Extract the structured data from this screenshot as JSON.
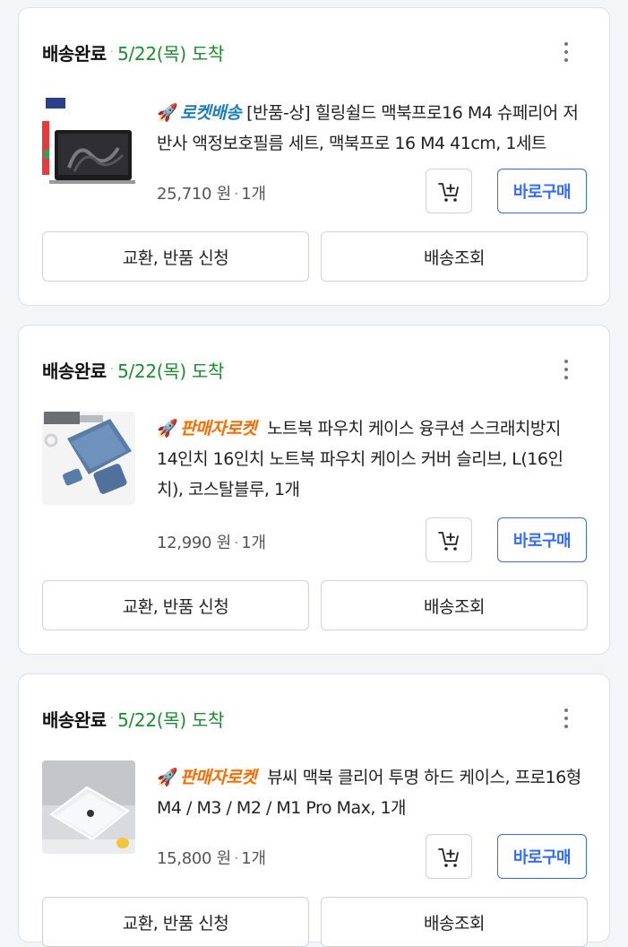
{
  "orders": [
    {
      "status": "배송완료",
      "separator": "·",
      "eta": "5/22(목) 도착",
      "badge": "로켓배송",
      "badge_icon": "rocket-icon",
      "title": "[반품-상] 힐링쉴드 맥북프로16 M4 슈페리어 저반사 액정보호필름 세트, 맥북프로 16 M4 41cm, 1세트",
      "price": "25,710 원",
      "quantity": "1개",
      "buy_label": "바로구매",
      "exchange_label": "교환, 반품 신청",
      "tracking_label": "배송조회"
    },
    {
      "status": "배송완료",
      "separator": "·",
      "eta": "5/22(목) 도착",
      "badge": "판매자로켓",
      "badge_icon": "rocket-icon",
      "title": "노트북 파우치 케이스 융쿠션 스크래치방지 14인치 16인치 노트북 파우치 케이스 커버 슬리브, L(16인치), 코스탈블루, 1개",
      "price": "12,990 원",
      "quantity": "1개",
      "buy_label": "바로구매",
      "exchange_label": "교환, 반품 신청",
      "tracking_label": "배송조회"
    },
    {
      "status": "배송완료",
      "separator": "·",
      "eta": "5/22(목) 도착",
      "badge": "판매자로켓",
      "badge_icon": "rocket-icon",
      "title": "뷰씨 맥북 클리어 투명 하드 케이스, 프로16형 M4 / M3 / M2 / M1 Pro Max, 1개",
      "price": "15,800 원",
      "quantity": "1개",
      "buy_label": "바로구매",
      "exchange_label": "교환, 반품 신청",
      "tracking_label": "배송조회"
    }
  ],
  "colors": {
    "status_green": "#198f2e",
    "rocket_blue": "#1a7dbf",
    "seller_orange": "#ff6a00",
    "buy_blue": "#346aff"
  }
}
